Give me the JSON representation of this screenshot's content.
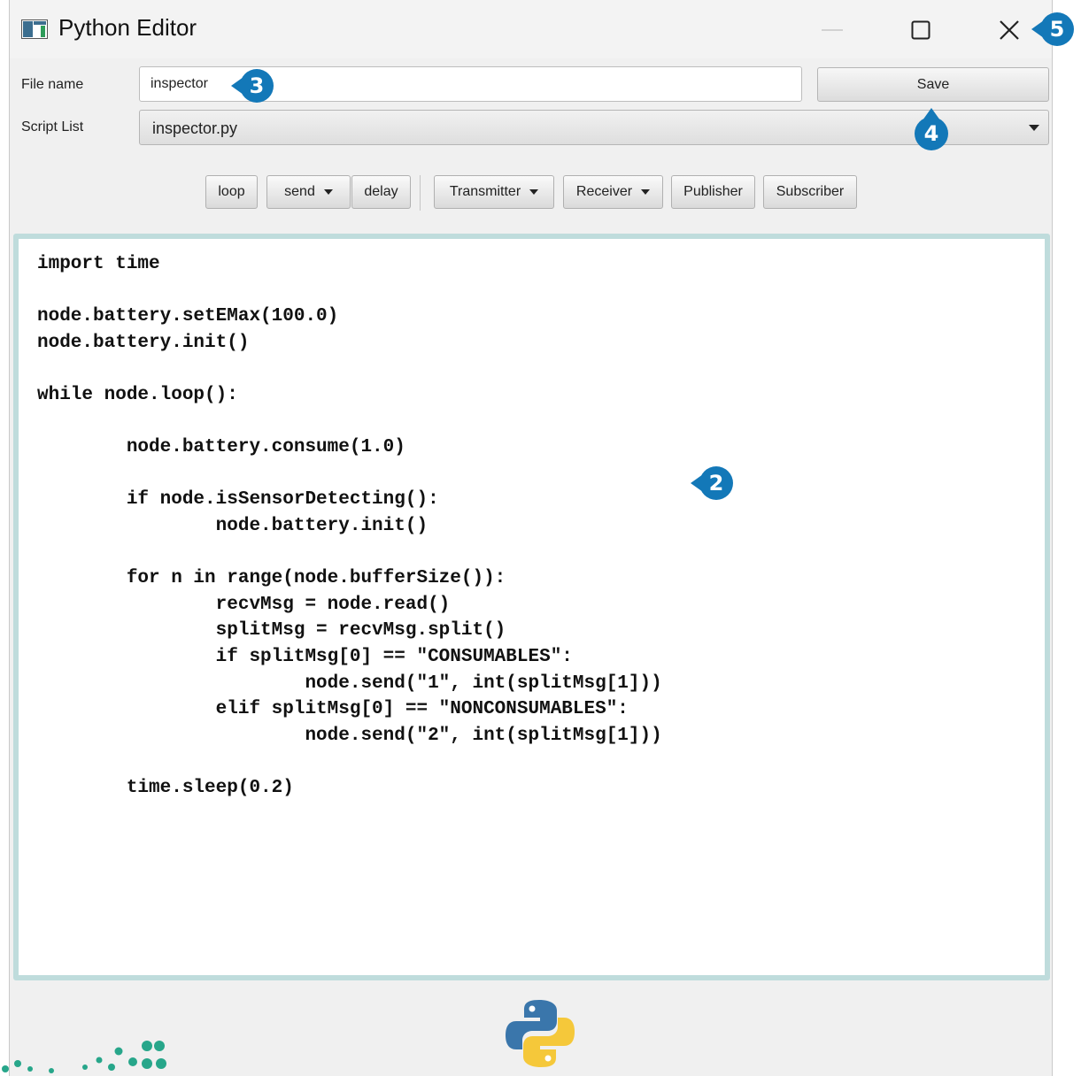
{
  "window": {
    "title": "Python Editor"
  },
  "form": {
    "file_name_label": "File name",
    "file_name_value": "inspector",
    "save_label": "Save",
    "script_list_label": "Script List",
    "script_list_value": "inspector.py"
  },
  "toolbar": {
    "loop": "loop",
    "send": "send",
    "delay": "delay",
    "transmitter": "Transmitter",
    "receiver": "Receiver",
    "publisher": "Publisher",
    "subscriber": "Subscriber"
  },
  "editor": {
    "code_lines": [
      "import time",
      "",
      "node.battery.setEMax(100.0)",
      "node.battery.init()",
      "",
      "while node.loop():",
      "",
      "        node.battery.consume(1.0)",
      "",
      "        if node.isSensorDetecting():",
      "                node.battery.init()",
      "",
      "        for n in range(node.bufferSize()):",
      "                recvMsg = node.read()",
      "                splitMsg = recvMsg.split()",
      "                if splitMsg[0] == \"CONSUMABLES\":",
      "                        node.send(\"1\", int(splitMsg[1]))",
      "                elif splitMsg[0] == \"NONCONSUMABLES\":",
      "                        node.send(\"2\", int(splitMsg[1]))",
      "",
      "        time.sleep(0.2)"
    ]
  },
  "annotations": {
    "b2": "2",
    "b3": "3",
    "b4": "4",
    "b5": "5"
  },
  "colors": {
    "badge": "#1378b8",
    "editor_border": "#bfdcdc",
    "window_bg": "#f0f0f0"
  },
  "icons": [
    "app-window-icon",
    "minimize-icon",
    "maximize-icon",
    "close-icon",
    "chevron-down-icon",
    "python-logo"
  ]
}
